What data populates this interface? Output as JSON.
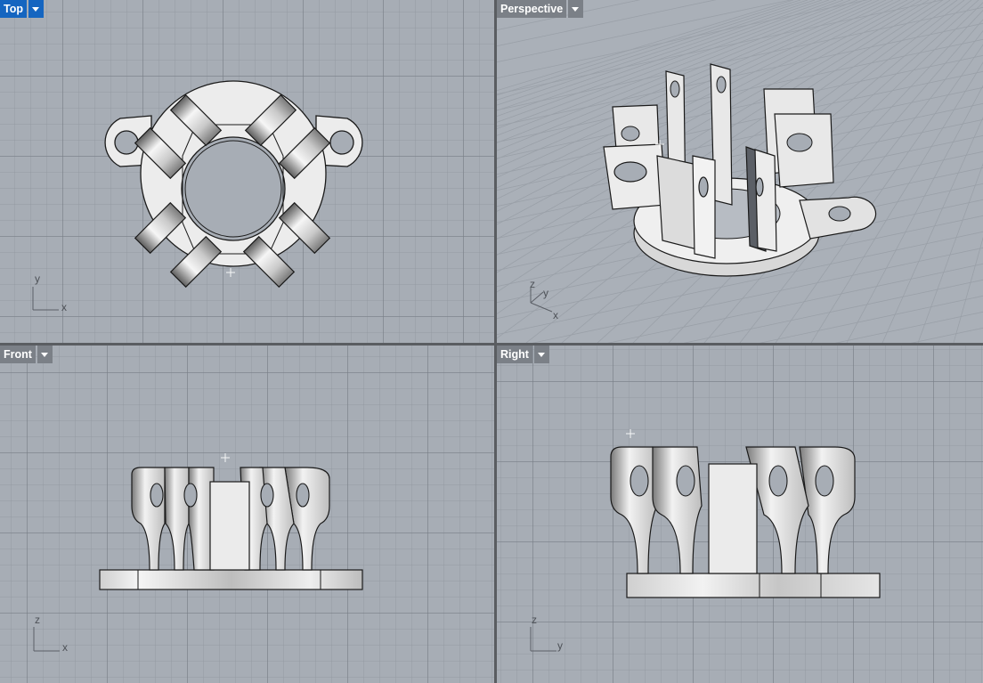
{
  "viewports": {
    "top": {
      "title": "Top",
      "axis_h": "x",
      "axis_v": "y"
    },
    "perspective": {
      "title": "Perspective",
      "axis_h": "x",
      "axis_v": "y",
      "axis_z": "z"
    },
    "front": {
      "title": "Front",
      "axis_h": "x",
      "axis_v": "z"
    },
    "right": {
      "title": "Right",
      "axis_h": "y",
      "axis_v": "z"
    }
  },
  "active_viewport": "top",
  "colors": {
    "active_label": "#1565c0",
    "inactive_label": "#7b8087",
    "viewport_bg": "#a7adb5",
    "model_fill": "#ececec",
    "model_edge": "#1a1a1a"
  }
}
